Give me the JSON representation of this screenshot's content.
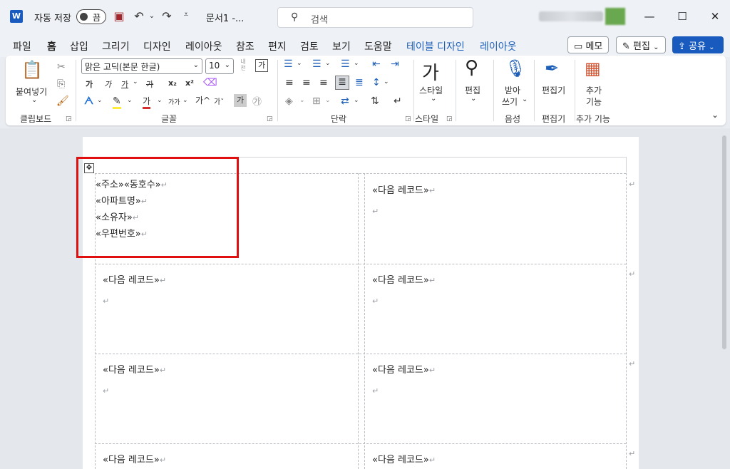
{
  "titlebar": {
    "app_logo": "W",
    "autosave_label": "자동 저장",
    "autosave_state": "끔",
    "document_title": "문서1  -...",
    "search_placeholder": "검색",
    "icons": [
      "save-icon",
      "undo-icon",
      "redo-icon",
      "customize-icon",
      "search-icon",
      "minimize-icon",
      "maximize-icon",
      "close-icon"
    ]
  },
  "menu": {
    "tabs": [
      "파일",
      "홈",
      "삽입",
      "그리기",
      "디자인",
      "레이아웃",
      "참조",
      "편지",
      "검토",
      "보기",
      "도움말",
      "테이블 디자인",
      "레이아웃"
    ],
    "active_tab": "홈",
    "memo_label": "메모",
    "edit_label": "편집",
    "share_label": "공유",
    "accent_color": "#185abd"
  },
  "ribbon": {
    "paste_label": "붙여넣기",
    "font_name": "맑은 고딕(본문 한글)",
    "font_size": "10",
    "style_label": "스타일",
    "edit_label": "편집",
    "dictate_label_1": "받아",
    "dictate_label_2": "쓰기",
    "editor_label": "편집기",
    "addins_label_1": "추가",
    "addins_label_2": "기능",
    "groups": {
      "clipboard": "클립보드",
      "font": "글꼴",
      "paragraph": "단락",
      "styles": "스타일",
      "voice": "음성",
      "editor": "편집기",
      "addins": "추가 기능"
    },
    "font_buttons": {
      "bold": "가",
      "italic": "가",
      "underline": "가",
      "strike": "가",
      "subscript": "x₂",
      "superscript": "x²",
      "grow": "가^",
      "shrink": "가ˇ",
      "case": "가가",
      "char_shade": "가",
      "color": "가",
      "enclose": "㉮",
      "phonetic_top": "내천",
      "border_char": "가"
    }
  },
  "document": {
    "first_cell_lines": [
      "«주소»«동호수»",
      "«아파트명»",
      "«소유자»",
      "«우편번호»"
    ],
    "next_record": "«다음 레코드»",
    "paragraph_mark": "↵",
    "highlight_color": "#e01010"
  }
}
